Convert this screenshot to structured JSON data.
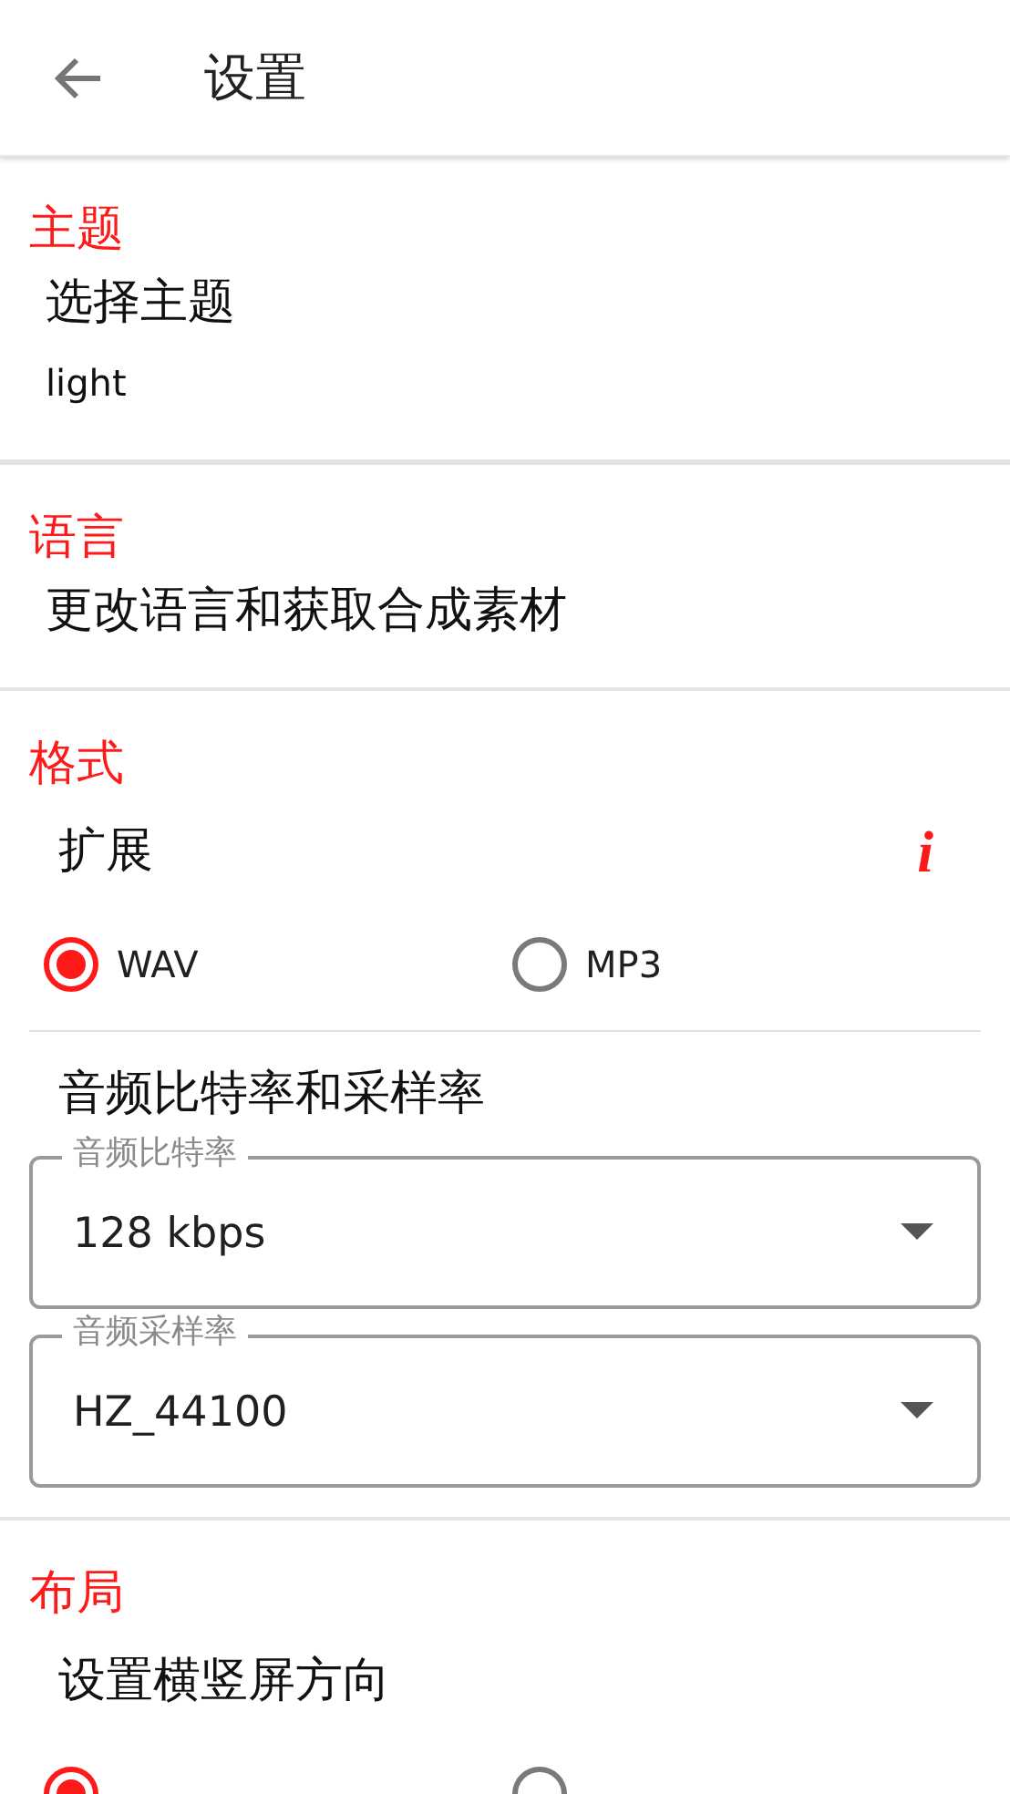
{
  "app_bar": {
    "title": "设置"
  },
  "sections": [
    {
      "heading": "主题",
      "items": [
        {
          "kind": "text",
          "title": "选择主题",
          "value": "light"
        }
      ]
    },
    {
      "heading": "语言",
      "items": [
        {
          "kind": "text",
          "title": "更改语言和获取合成素材"
        }
      ]
    },
    {
      "heading": "格式",
      "items": [
        {
          "kind": "radios",
          "title": "扩展",
          "info": "i",
          "options": [
            {
              "label": "WAV",
              "selected": true
            },
            {
              "label": "MP3",
              "selected": false
            }
          ]
        },
        {
          "kind": "selects",
          "title": "音频比特率和采样率",
          "fields": [
            {
              "label": "音频比特率",
              "value": "128 kbps"
            },
            {
              "label": "音频采样率",
              "value": "HZ_44100"
            }
          ]
        }
      ]
    },
    {
      "heading": "布局",
      "items": [
        {
          "kind": "radios",
          "title": "设置横竖屏方向",
          "options": [
            {
              "selected": true
            },
            {
              "selected": false
            }
          ]
        }
      ]
    }
  ]
}
